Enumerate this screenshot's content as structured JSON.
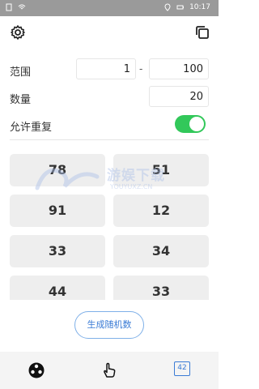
{
  "status_bar": {
    "time": "10:17",
    "left_icons": [
      "file-icon",
      "wifi-icon"
    ],
    "right_icons": [
      "location-icon",
      "battery-icon"
    ]
  },
  "toolbar": {
    "settings_icon": "gear-icon",
    "copy_icon": "copy-icon"
  },
  "form": {
    "range_label": "范围",
    "range_min": "1",
    "range_separator": "-",
    "range_max": "100",
    "count_label": "数量",
    "count_value": "20",
    "allow_repeat_label": "允许重复",
    "allow_repeat_on": true
  },
  "results": [
    "78",
    "51",
    "91",
    "12",
    "33",
    "34",
    "44",
    "33"
  ],
  "watermark": {
    "text": "游娱下载",
    "sub": "YOUYUXZ.CN"
  },
  "generate_button": "生成随机数",
  "bottom_nav": {
    "tab3_badge": "42"
  },
  "colors": {
    "accent": "#3a7bd5",
    "toggle_on": "#32c85a",
    "status_bar": "#9a9a9a",
    "cell_bg": "#eeeeee"
  }
}
